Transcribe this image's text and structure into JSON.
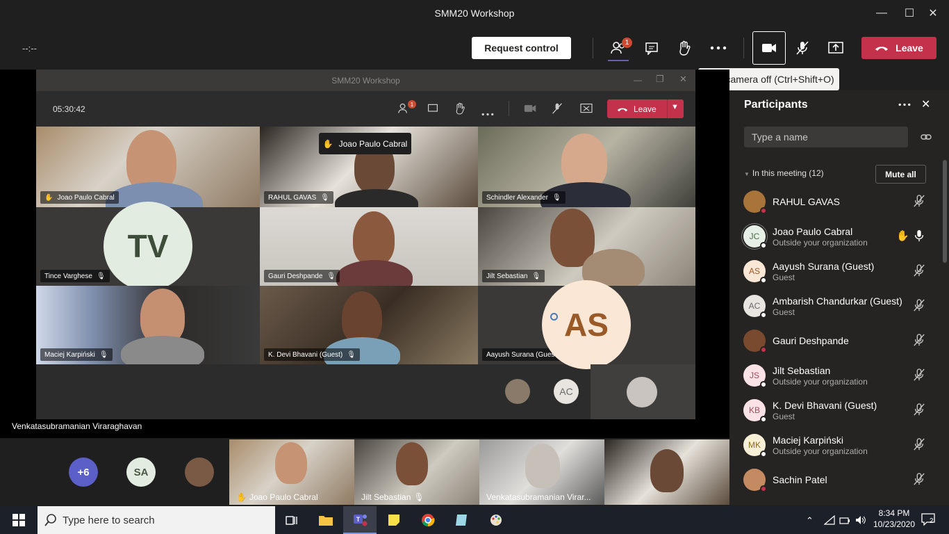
{
  "window": {
    "title": "SMM20 Workshop"
  },
  "toolbar": {
    "timer": "--:--",
    "request_control": "Request control",
    "participants_badge": "1",
    "leave": "Leave",
    "tooltip": "Turn camera off (Ctrl+Shift+O)"
  },
  "inner_window": {
    "title": "SMM20 Workshop",
    "timer": "05:30:42",
    "leave": "Leave",
    "participants_badge": "1",
    "hand_popup": "Joao Paulo Cabral"
  },
  "grid": [
    {
      "name": "Joao Paulo Cabral",
      "hand": true
    },
    {
      "name": "RAHUL GAVAS"
    },
    {
      "name": "Schindler Alexander"
    },
    {
      "name": "Tince Varghese",
      "initials": "TV"
    },
    {
      "name": "Gauri Deshpande"
    },
    {
      "name": "Jilt Sebastian"
    },
    {
      "name": "Maciej Karpiński"
    },
    {
      "name": "K. Devi Bhavani (Guest)"
    },
    {
      "name": "Aayush Surana (Guest)",
      "initials": "AS"
    }
  ],
  "overflow_avatars": {
    "ac": "AC"
  },
  "pinned_name": "Venkatasubramanian Viraraghavan",
  "bottom_strip": {
    "more": "+6",
    "sa": "SA",
    "tiles": [
      "Joao Paulo Cabral",
      "Jilt Sebastian",
      "Venkatasubramanian Virar..."
    ]
  },
  "panel": {
    "title": "Participants",
    "search_placeholder": "Type a name",
    "section": "In this meeting (12)",
    "mute_all": "Mute all",
    "people": [
      {
        "name": "RAHUL GAVAS",
        "sub": "",
        "initials": "",
        "status": "busy"
      },
      {
        "name": "Joao Paulo Cabral",
        "sub": "Outside your organization",
        "initials": "JC",
        "status": "offline"
      },
      {
        "name": "Aayush Surana (Guest)",
        "sub": "Guest",
        "initials": "AS",
        "status": "offline"
      },
      {
        "name": "Ambarish Chandurkar (Guest)",
        "sub": "Guest",
        "initials": "AC",
        "status": "offline"
      },
      {
        "name": "Gauri Deshpande",
        "sub": "",
        "initials": "",
        "status": "busy"
      },
      {
        "name": "Jilt Sebastian",
        "sub": "Outside your organization",
        "initials": "JS",
        "status": "offline"
      },
      {
        "name": "K. Devi Bhavani (Guest)",
        "sub": "Guest",
        "initials": "KB",
        "status": "offline"
      },
      {
        "name": "Maciej Karpiński",
        "sub": "Outside your organization",
        "initials": "MK",
        "status": "offline"
      },
      {
        "name": "Sachin Patel",
        "sub": "",
        "initials": "",
        "status": "busy"
      }
    ]
  },
  "taskbar": {
    "search_placeholder": "Type here to search",
    "time": "8:34 PM",
    "date": "10/23/2020",
    "notification_count": "2"
  },
  "colors": {
    "leave_red": "#c4314b",
    "panel_bg": "#252423",
    "accent": "#6264a7"
  }
}
